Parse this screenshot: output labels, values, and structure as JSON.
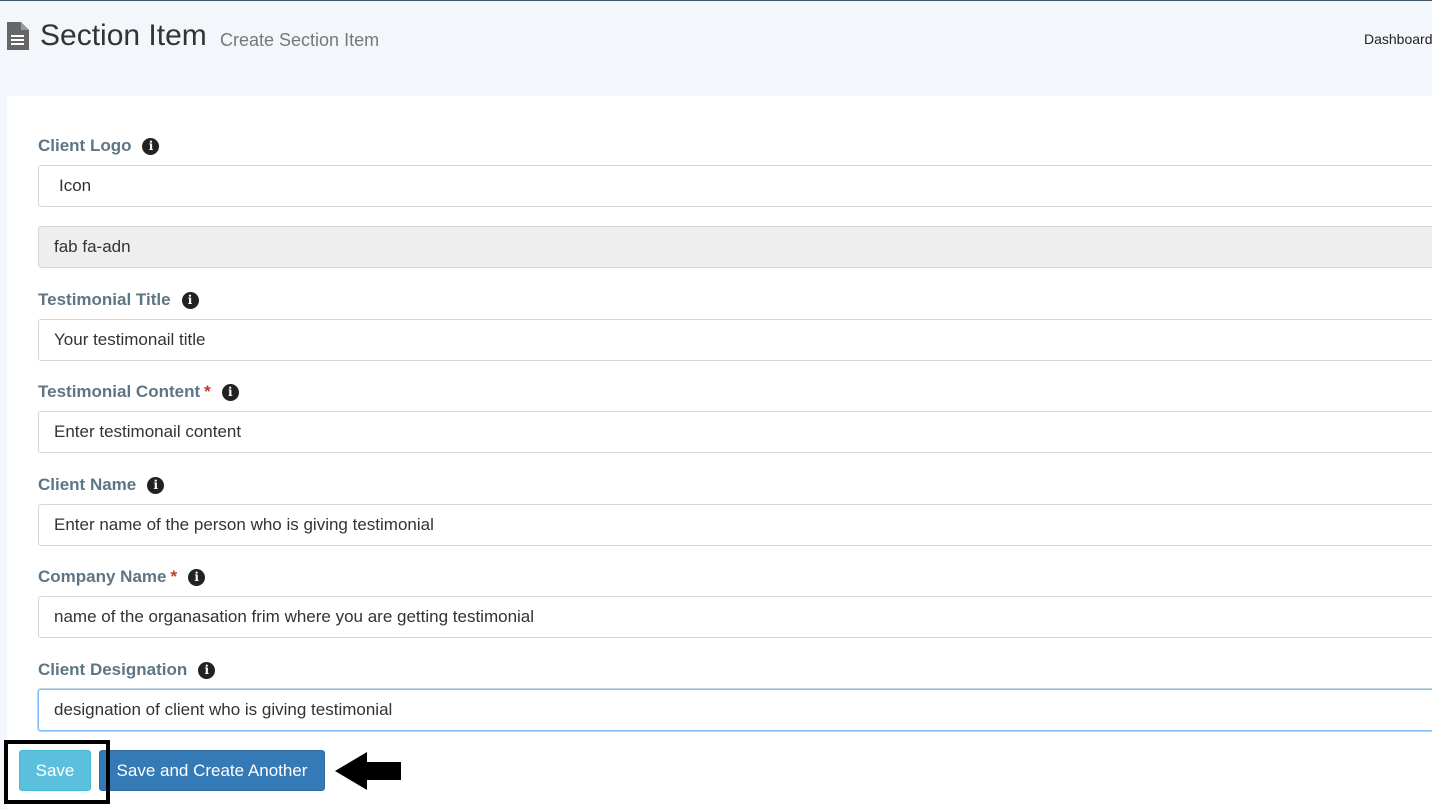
{
  "header": {
    "title": "Section Item",
    "subtitle": "Create Section Item",
    "breadcrumb": "Dashboard"
  },
  "form": {
    "client_logo": {
      "label": "Client Logo",
      "picker_value": "Icon",
      "icon_class_value": "fab fa-adn"
    },
    "testimonial_title": {
      "label": "Testimonial Title",
      "value": "Your testimonail title"
    },
    "testimonial_content": {
      "label": "Testimonial Content",
      "required_mark": "*",
      "value": "Enter testimonail content"
    },
    "client_name": {
      "label": "Client Name",
      "value": "Enter name of the person who is giving testimonial"
    },
    "company_name": {
      "label": "Company Name",
      "required_mark": "*",
      "value": "name of the organasation frim where you are getting testimonial"
    },
    "client_designation": {
      "label": "Client Designation",
      "value": "designation of client who is giving testimonial"
    }
  },
  "buttons": {
    "save_label": "Save",
    "save_another_label": "Save and Create Another"
  },
  "icons": {
    "page": "file-text-icon",
    "info": "info-icon",
    "annotation": "arrow-left-icon"
  },
  "colors": {
    "label": "#5e7585",
    "required": "#c0392b",
    "save_button": "#5bc0de",
    "save_another_button": "#337ab7"
  }
}
